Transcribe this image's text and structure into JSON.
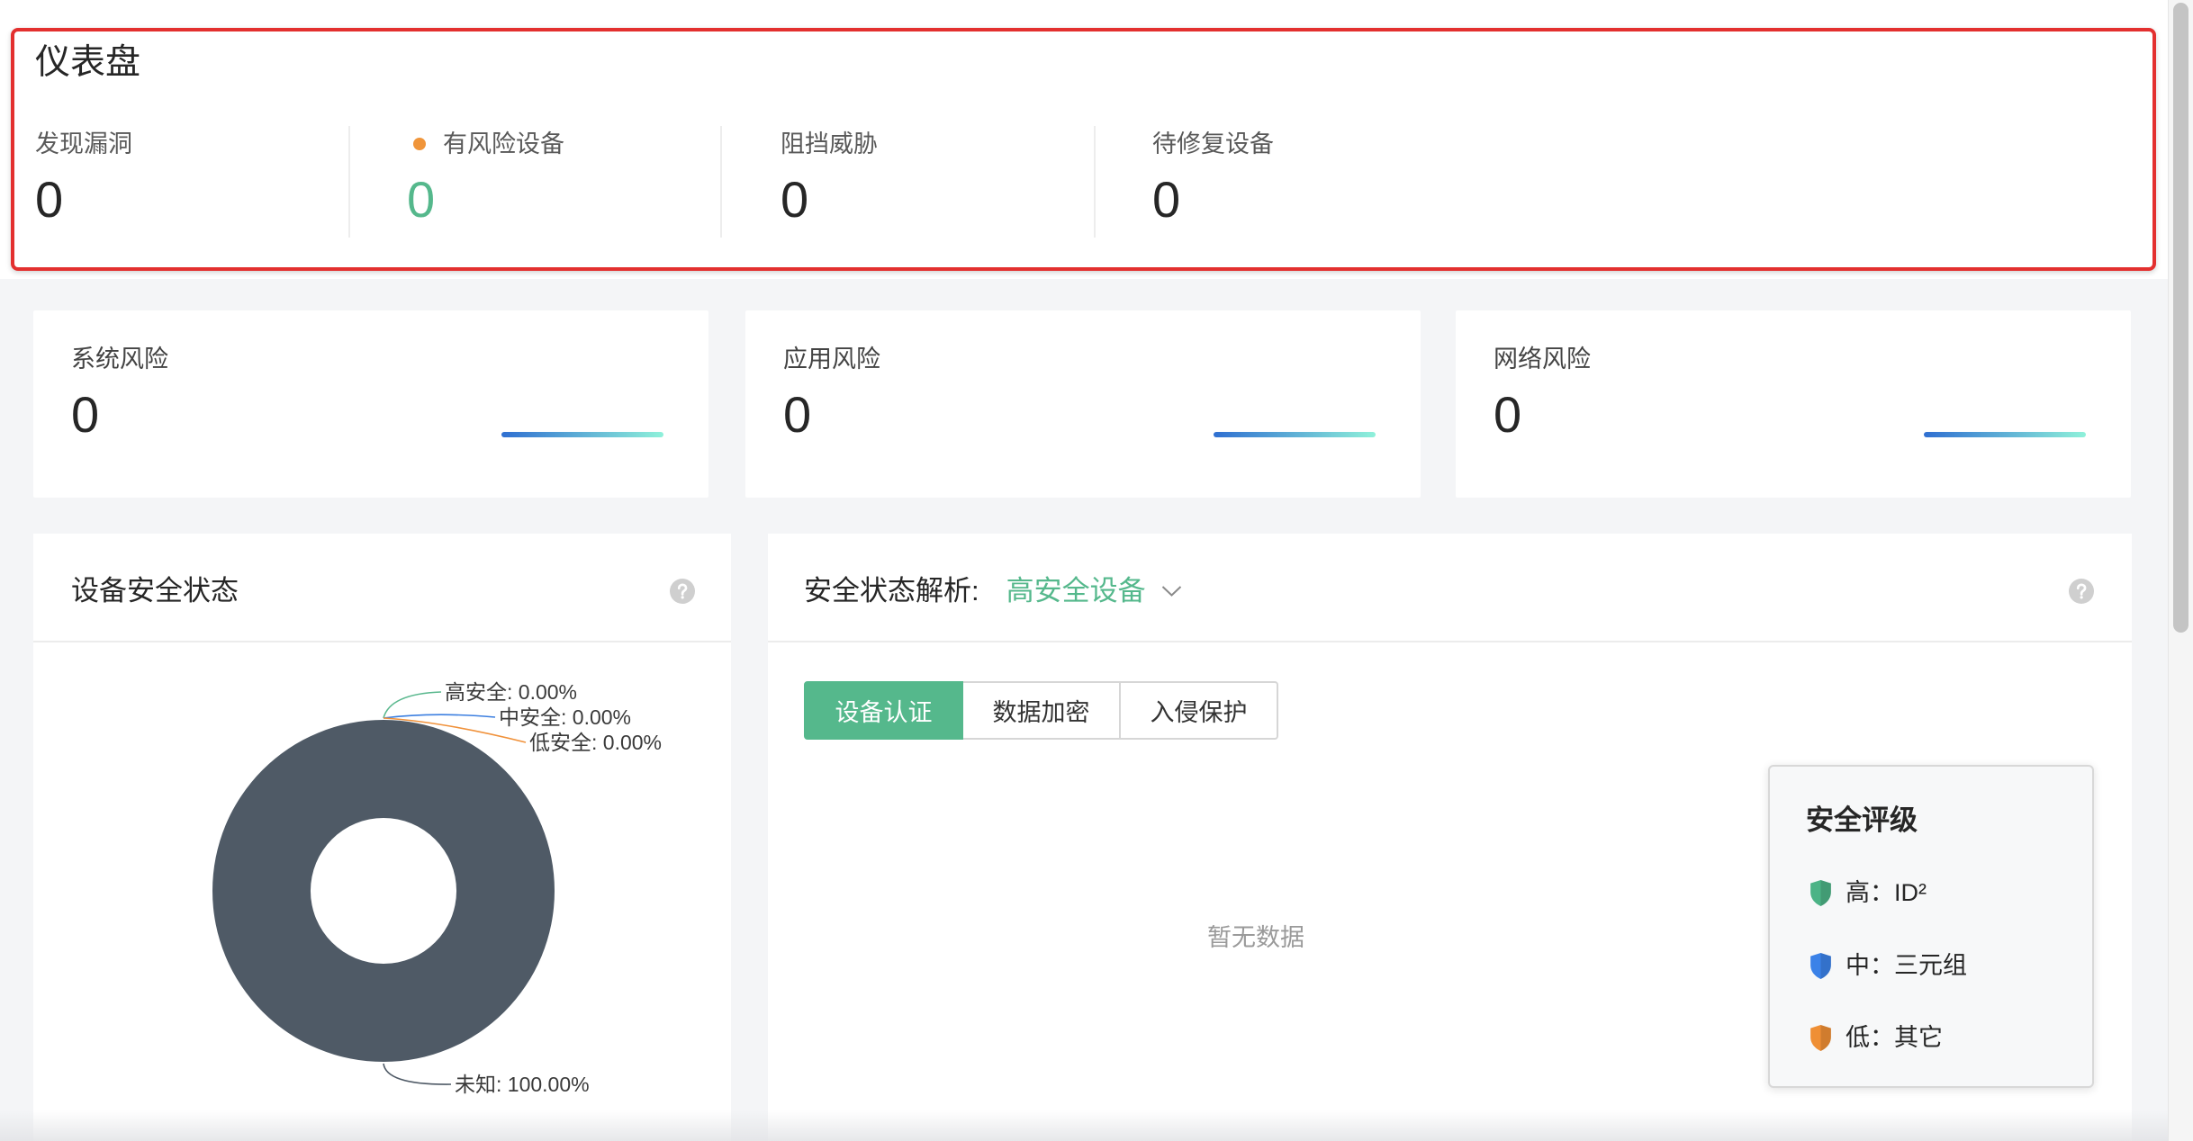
{
  "header": {
    "title": "仪表盘"
  },
  "stats": [
    {
      "label": "发现漏洞",
      "value": "0"
    },
    {
      "label": "有风险设备",
      "value": "0"
    },
    {
      "label": "阻挡威胁",
      "value": "0"
    },
    {
      "label": "待修复设备",
      "value": "0"
    }
  ],
  "risk_cards": [
    {
      "label": "系统风险",
      "value": "0"
    },
    {
      "label": "应用风险",
      "value": "0"
    },
    {
      "label": "网络风险",
      "value": "0"
    }
  ],
  "device_status": {
    "title": "设备安全状态"
  },
  "analysis": {
    "title": "安全状态解析:",
    "selected": "高安全设备",
    "tabs": [
      {
        "label": "设备认证",
        "active": true
      },
      {
        "label": "数据加密",
        "active": false
      },
      {
        "label": "入侵保护",
        "active": false
      }
    ],
    "empty_text": "暂无数据"
  },
  "legend": {
    "title": "安全评级",
    "items": [
      {
        "text": "高：ID²",
        "color": "#4cb386",
        "icon": "shield-icon"
      },
      {
        "text": "中：三元组",
        "color": "#3b82e8",
        "icon": "shield-icon"
      },
      {
        "text": "低：其它",
        "color": "#ef8f35",
        "icon": "shield-icon"
      }
    ]
  },
  "icons": {
    "help": "help-icon",
    "dropdown": "chevron-down-icon",
    "risk_dot": "status-dot",
    "legend": "shield-icon"
  },
  "colors": {
    "accent": "#55b88c",
    "risk_dot": "#f0953a",
    "trend_start": "#2f6fd1",
    "trend_end": "#8ff1da"
  },
  "chart_data": {
    "type": "pie",
    "variant": "donut",
    "categories": [
      "高安全",
      "中安全",
      "低安全",
      "未知"
    ],
    "values": [
      0,
      0,
      0,
      100
    ],
    "percent_labels": [
      "0.00%",
      "0.00%",
      "0.00%",
      "100.00%"
    ],
    "label_separator": ": ",
    "colors": [
      "#5ab88e",
      "#3c7fe0",
      "#f0913a",
      "#4f5a66"
    ],
    "legend": "none"
  }
}
